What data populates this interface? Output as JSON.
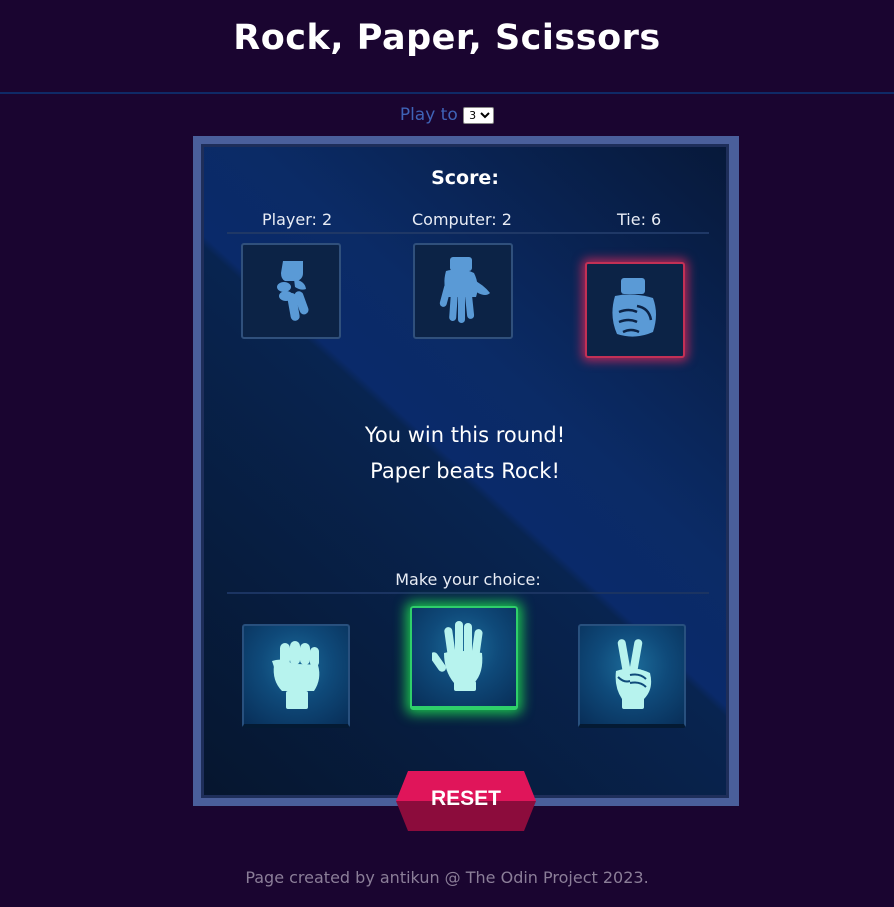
{
  "title": "Rock, Paper, Scissors",
  "play_to": {
    "label": "Play to",
    "selected": "3"
  },
  "score": {
    "title": "Score:",
    "player": "Player: 2",
    "computer": "Computer: 2",
    "tie": "Tie: 6"
  },
  "last_round": {
    "player_pick": "scissors",
    "computer_pick": "paper",
    "highlighted_pick": "rock"
  },
  "result": {
    "line1": "You win this round!",
    "line2": "Paper beats Rock!"
  },
  "choices": {
    "prompt": "Make your choice:",
    "options": [
      "rock",
      "paper",
      "scissors"
    ],
    "active": "paper"
  },
  "reset_label": "RESET",
  "footer": "Page created by antikun @ The Odin Project 2023.",
  "colors": {
    "background": "#1a0530",
    "board": "#082450",
    "hand_dark": "#5a9ad6",
    "hand_light": "#b7f3ee",
    "active_glow": "#1edc50",
    "highlight_glow": "#e6285a",
    "reset": "#e0155a"
  }
}
